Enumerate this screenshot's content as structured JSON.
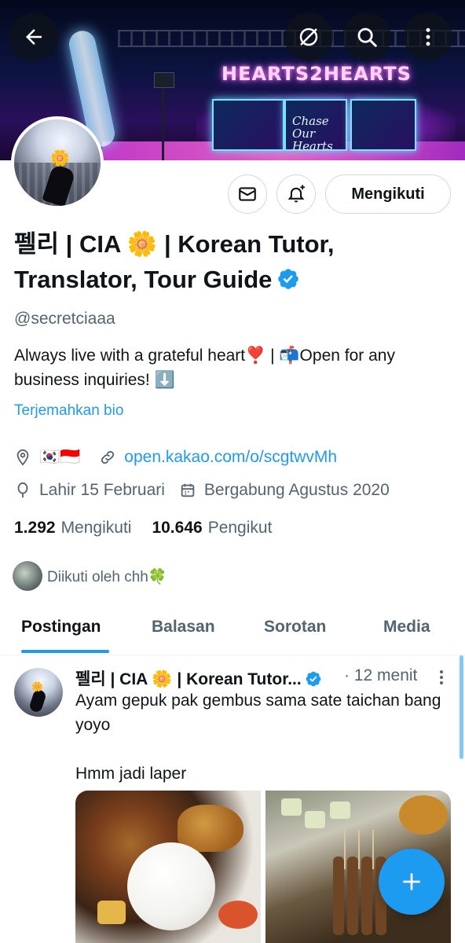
{
  "header": {
    "banner_stage_text": "HEARTS2HEARTS",
    "banner_screen_text": "Chase Our Hearts",
    "back_icon": "arrow-left-icon",
    "hide_icon": "slash-circle-icon",
    "search_icon": "search-icon",
    "more_icon": "more-vertical-icon"
  },
  "profile": {
    "display_name": "펠리 | CIA 🌼 | Korean Tutor, Translator, Tour Guide",
    "handle": "@secretciaaa",
    "bio": "Always live with a grateful heart❣️ | 📬Open for any business inquiries! ⬇️",
    "translate_bio": "Terjemahkan bio",
    "location": "🇰🇷🇮🇩",
    "link": "open.kakao.com/o/scgtwvMh",
    "birthday": "Lahir 15 Februari",
    "joined": "Bergabung Agustus 2020",
    "following_count": "1.292",
    "following_label": "Mengikuti",
    "followers_count": "10.646",
    "followers_label": "Pengikut",
    "followed_by": "Diikuti oleh chh🍀",
    "follow_button": "Mengikuti"
  },
  "tabs": [
    "Postingan",
    "Balasan",
    "Sorotan",
    "Media"
  ],
  "active_tab": "Postingan",
  "post": {
    "author": "펠리 | CIA 🌼 | Korean Tutor...",
    "time": "· 12 menit",
    "text": "Ayam gepuk pak gembus sama sate taichan bang yoyo\n\nHmm jadi laper"
  },
  "colors": {
    "accent": "#1d9bf0",
    "text_primary": "#0f1419",
    "text_secondary": "#536471",
    "border": "#cfd9de"
  }
}
